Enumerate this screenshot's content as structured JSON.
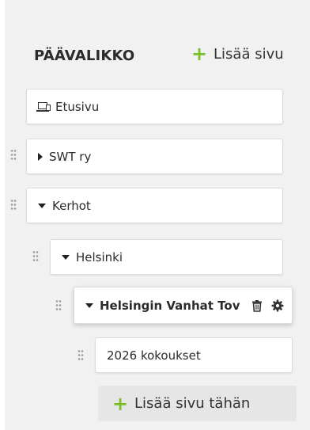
{
  "menu": {
    "title": "PÄÄVALIKKO",
    "add_page_label": "Lisää sivu",
    "add_here_label": "Lisää sivu tähän",
    "accent_color": "#7bbf2a"
  },
  "nodes": [
    {
      "label": "Etusivu",
      "icon": "home-screen-icon"
    },
    {
      "label": "SWT ry",
      "state": "collapsed"
    },
    {
      "label": "Kerhot",
      "state": "expanded"
    },
    {
      "label": "Helsinki",
      "state": "expanded"
    },
    {
      "label": "Helsingin Vanhat Tov",
      "state": "expanded",
      "selected": true
    },
    {
      "label": "2026 kokoukset"
    }
  ]
}
